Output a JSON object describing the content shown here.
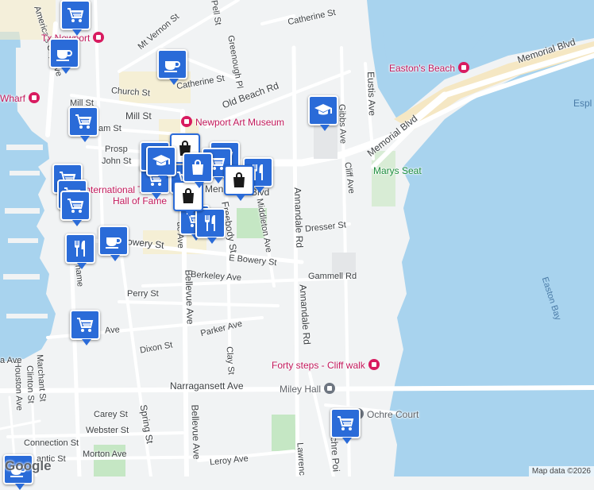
{
  "streets": [
    {
      "id": "catherine-st-n",
      "text": "Catherine St"
    },
    {
      "id": "pell-st",
      "text": "Pell St"
    },
    {
      "id": "mt-vernon-st",
      "text": "Mt Vernon St"
    },
    {
      "id": "greenough-pl",
      "text": "Greenough Pl"
    },
    {
      "id": "americas-cup-ave",
      "text": "America's Cup Ave"
    },
    {
      "id": "church-st",
      "text": "Church St"
    },
    {
      "id": "catherine-st",
      "text": "Catherine St"
    },
    {
      "id": "old-beach-rd",
      "text": "Old Beach Rd"
    },
    {
      "id": "mill-st",
      "text": "Mill St"
    },
    {
      "id": "mill-st-2",
      "text": "Mill St"
    },
    {
      "id": "pelham-st",
      "text": "Pelham St"
    },
    {
      "id": "prospect",
      "text": "Prosp"
    },
    {
      "id": "john-st",
      "text": "John St"
    },
    {
      "id": "memorial-blvd-top",
      "text": "Memorial Blvd"
    },
    {
      "id": "memorial-blvd-mid",
      "text": "Memorial Blvd"
    },
    {
      "id": "memorial-blvd-west",
      "text": "Men"
    },
    {
      "id": "memorial-blvd-west-2",
      "text": "Blvd"
    },
    {
      "id": "eustis-ave",
      "text": "Eustis Ave"
    },
    {
      "id": "gibbs-ave",
      "text": "Gibbs Ave"
    },
    {
      "id": "cliff-ave",
      "text": "Cliff Ave"
    },
    {
      "id": "annandale-rd",
      "text": "Annandale Rd"
    },
    {
      "id": "annandale-rd-2",
      "text": "Annandale Rd"
    },
    {
      "id": "middleton-ave",
      "text": "Middleton Ave"
    },
    {
      "id": "freebody-st",
      "text": "Freebody St"
    },
    {
      "id": "dresser-st",
      "text": "Dresser St"
    },
    {
      "id": "bowery-st",
      "text": "Bowery St"
    },
    {
      "id": "e-bowery-st",
      "text": "E Bowery St"
    },
    {
      "id": "bellevue-ave",
      "text": "Bellevue Ave"
    },
    {
      "id": "bellevue-ave-top",
      "text": "ue Ave"
    },
    {
      "id": "gammell-rd",
      "text": "Gammell Rd"
    },
    {
      "id": "berkeley-ave",
      "text": "Berkeley Ave"
    },
    {
      "id": "perry-st",
      "text": "Perry St"
    },
    {
      "id": "thames",
      "text": "Thame"
    },
    {
      "id": "ave-stub",
      "text": "Ave"
    },
    {
      "id": "parker-ave",
      "text": "Parker Ave"
    },
    {
      "id": "dixon-st",
      "text": "Dixon St"
    },
    {
      "id": "clay-st",
      "text": "Clay St"
    },
    {
      "id": "houston-ave",
      "text": "Houston Ave"
    },
    {
      "id": "clinton-st",
      "text": "Clinton St"
    },
    {
      "id": "marchant-st",
      "text": "Marchant St"
    },
    {
      "id": "narragansett-ave",
      "text": "Narragansett Ave"
    },
    {
      "id": "spring-st",
      "text": "Spring St"
    },
    {
      "id": "bellevue-ave-2",
      "text": "Bellevue Ave"
    },
    {
      "id": "carey-st",
      "text": "Carey St"
    },
    {
      "id": "webster-st",
      "text": "Webster St"
    },
    {
      "id": "connection-st",
      "text": "Connection St"
    },
    {
      "id": "morton-ave",
      "text": "Morton Ave"
    },
    {
      "id": "antic-st",
      "text": "antic St"
    },
    {
      "id": "leroy-ave",
      "text": "Leroy Ave"
    },
    {
      "id": "lawrence",
      "text": "Lawrenc"
    },
    {
      "id": "ochre-point",
      "text": "chre Poi"
    },
    {
      "id": "a-ave",
      "text": "a Ave"
    }
  ],
  "pois": [
    {
      "id": "eastons-beach",
      "text": "Easton's Beach",
      "color": "pink"
    },
    {
      "id": "newport-art-museum",
      "text": "Newport Art Museum",
      "color": "pink"
    },
    {
      "id": "marys-seat",
      "text": "Marys Seat",
      "color": "green"
    },
    {
      "id": "forty-steps",
      "text": "Forty steps - Cliff walk",
      "color": "pink"
    },
    {
      "id": "miley-hall",
      "text": "Miley Hall",
      "color": "grey"
    },
    {
      "id": "ochre-court",
      "text": "Ochre Court",
      "color": "grey"
    },
    {
      "id": "wharf",
      "text": "Wharf",
      "color": "pink"
    },
    {
      "id": "tennis-hall",
      "text": "International Tennis",
      "color": "pink"
    },
    {
      "id": "hall-of-fame",
      "text": "Hall of Fame",
      "color": "pink"
    },
    {
      "id": "newport-top",
      "text": "Tx Newport",
      "color": "pink"
    }
  ],
  "water_labels": [
    {
      "id": "easton-bay",
      "text": "Easton Bay"
    },
    {
      "id": "esplanade",
      "text": "Espl"
    }
  ],
  "markers": [
    {
      "id": "m-coffee-1",
      "icon": "coffee-icon"
    },
    {
      "id": "m-coffee-2",
      "icon": "coffee-icon"
    },
    {
      "id": "m-coffee-3",
      "icon": "coffee-icon"
    },
    {
      "id": "m-coffee-4",
      "icon": "coffee-icon"
    },
    {
      "id": "m-school",
      "icon": "graduation-cap-icon"
    },
    {
      "id": "m-cart-1",
      "icon": "shopping-cart-icon"
    },
    {
      "id": "m-cart-2",
      "icon": "shopping-cart-icon"
    },
    {
      "id": "m-cart-3",
      "icon": "shopping-cart-icon"
    },
    {
      "id": "m-cart-4",
      "icon": "shopping-cart-icon"
    },
    {
      "id": "m-cart-5",
      "icon": "shopping-cart-icon"
    },
    {
      "id": "m-cart-6",
      "icon": "shopping-cart-icon"
    },
    {
      "id": "m-cart-7",
      "icon": "shopping-cart-icon"
    },
    {
      "id": "m-cart-8",
      "icon": "shopping-cart-icon"
    },
    {
      "id": "m-cart-9",
      "icon": "shopping-cart-icon"
    },
    {
      "id": "m-cart-10",
      "icon": "shopping-cart-icon"
    },
    {
      "id": "m-cart-11",
      "icon": "shopping-cart-icon"
    },
    {
      "id": "m-food-1",
      "icon": "fork-knife-icon"
    },
    {
      "id": "m-food-2",
      "icon": "fork-knife-icon"
    },
    {
      "id": "m-food-3",
      "icon": "fork-knife-icon"
    },
    {
      "id": "m-food-4",
      "icon": "fork-knife-icon"
    },
    {
      "id": "m-bag-1",
      "icon": "shopping-bag-icon"
    },
    {
      "id": "m-bag-2",
      "icon": "shopping-bag-icon"
    },
    {
      "id": "m-bag-3",
      "icon": "shopping-bag-icon"
    },
    {
      "id": "m-bag-4",
      "icon": "shopping-bag-icon"
    },
    {
      "id": "m-partial-top",
      "icon": "shopping-cart-icon"
    },
    {
      "id": "m-partial-bottom",
      "icon": "graduation-cap-icon"
    }
  ],
  "google_logo": "Google",
  "attribution": "Map data ©2026",
  "colors": {
    "water": "#a8d3ee",
    "land": "#f1f3f4",
    "park": "#c5e7c4",
    "sand": "#f5e7c3",
    "pin": "#2a6bd8",
    "poi_pink": "#c2185b",
    "poi_green": "#1e8e3e"
  }
}
